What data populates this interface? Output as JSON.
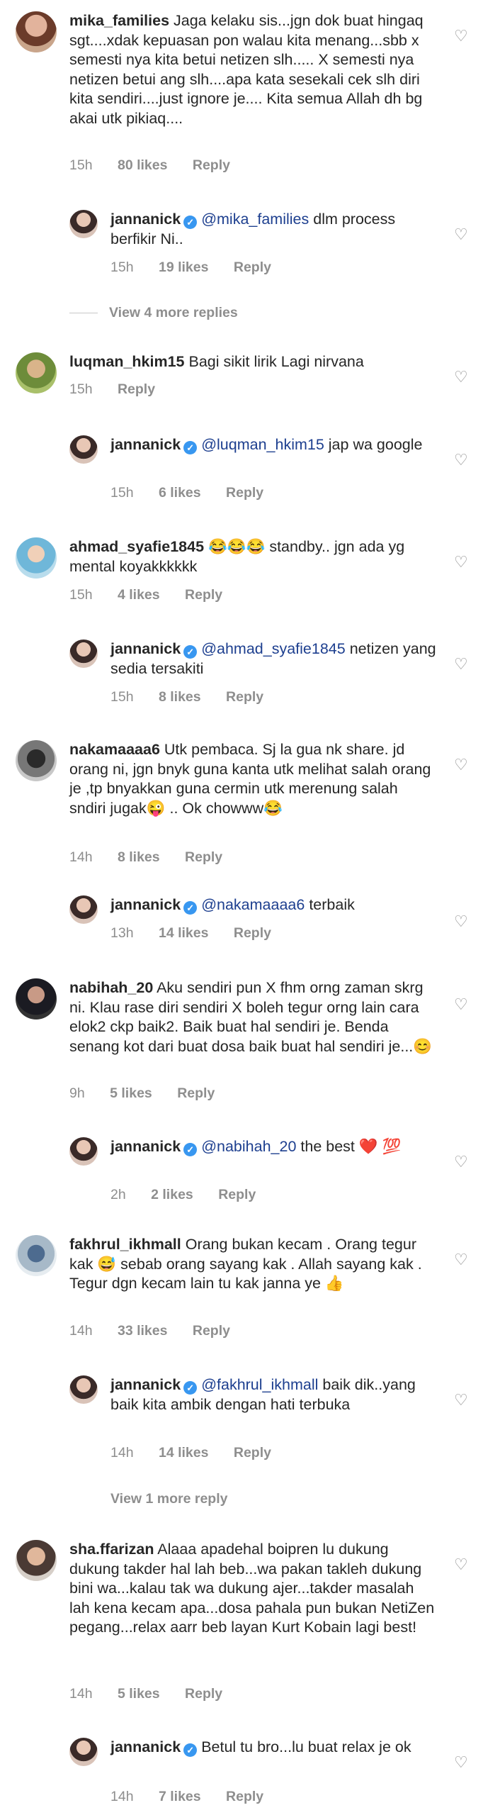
{
  "comments": [
    {
      "id": "c1",
      "user": "mika_families",
      "text": "Jaga kelaku sis...jgn dok buat hingaq sgt....xdak kepuasan pon walau kita menang...sbb x semesti nya kita betui netizen slh..... X semesti nya netizen betui ang slh....apa kata sesekali cek slh diri kita sendiri....just ignore je.... Kita semua Allah dh bg akai utk pikiaq....",
      "time": "15h",
      "likes": "80 likes",
      "reply_label": "Reply"
    },
    {
      "id": "r1",
      "user": "jannanick",
      "mention": "@mika_families",
      "text": "dlm process berfikir Ni..",
      "time": "15h",
      "likes": "19 likes",
      "reply_label": "Reply"
    },
    {
      "id": "c2",
      "user": "luqman_hkim15",
      "text": "Bagi sikit lirik Lagi nirvana",
      "time": "15h",
      "reply_label": "Reply"
    },
    {
      "id": "r2",
      "user": "jannanick",
      "mention": "@luqman_hkim15",
      "text": "jap wa google",
      "time": "15h",
      "likes": "6 likes",
      "reply_label": "Reply"
    },
    {
      "id": "c3",
      "user": "ahmad_syafie1845",
      "text": "😂😂😂 standby.. jgn ada yg mental koyakkkkkk",
      "time": "15h",
      "likes": "4 likes",
      "reply_label": "Reply"
    },
    {
      "id": "r3",
      "user": "jannanick",
      "mention": "@ahmad_syafie1845",
      "text": "netizen yang sedia tersakiti",
      "time": "15h",
      "likes": "8 likes",
      "reply_label": "Reply"
    },
    {
      "id": "c4",
      "user": "nakamaaaa6",
      "text": "Utk pembaca. Sj la gua nk share. jd orang ni, jgn bnyk guna kanta utk melihat salah orang je ,tp bnyakkan guna cermin utk merenung salah sndiri jugak😜 .. Ok chowww😂",
      "time": "14h",
      "likes": "8 likes",
      "reply_label": "Reply"
    },
    {
      "id": "r4",
      "user": "jannanick",
      "mention": "@nakamaaaa6",
      "text": "terbaik",
      "time": "13h",
      "likes": "14 likes",
      "reply_label": "Reply"
    },
    {
      "id": "c5",
      "user": "nabihah_20",
      "text": "Aku sendiri pun X fhm orng zaman skrg ni.  Klau rase diri sendiri X boleh tegur orng lain cara elok2 ckp baik2.  Baik buat hal sendiri je. Benda senang kot dari buat dosa baik buat hal sendiri je...😊",
      "time": "9h",
      "likes": "5 likes",
      "reply_label": "Reply"
    },
    {
      "id": "r5",
      "user": "jannanick",
      "mention": "@nabihah_20",
      "text": "the best ❤️ 💯",
      "time": "2h",
      "likes": "2 likes",
      "reply_label": "Reply"
    },
    {
      "id": "c6",
      "user": "fakhrul_ikhmall",
      "text": "Orang bukan kecam . Orang tegur kak 😅 sebab orang sayang kak . Allah sayang kak . Tegur dgn kecam lain tu kak janna ye 👍",
      "time": "14h",
      "likes": "33 likes",
      "reply_label": "Reply"
    },
    {
      "id": "r6",
      "user": "jannanick",
      "mention": "@fakhrul_ikhmall",
      "text": "baik dik..yang baik kita ambik dengan hati terbuka",
      "time": "14h",
      "likes": "14 likes",
      "reply_label": "Reply"
    },
    {
      "id": "c7",
      "user": "sha.ffarizan",
      "text": "Alaaa apadehal boipren lu dukung dukung takder hal lah beb...wa pakan takleh dukung bini wa...kalau tak wa dukung ajer...takder masalah lah kena kecam apa...dosa pahala pun bukan NetiZen pegang...relax aarr beb layan Kurt Kobain lagi best!",
      "time": "14h",
      "likes": "5 likes",
      "reply_label": "Reply"
    },
    {
      "id": "r7",
      "user": "jannanick",
      "text": "Betul tu bro...lu buat relax je ok",
      "time": "14h",
      "likes": "7 likes",
      "reply_label": "Reply"
    }
  ],
  "view_more": {
    "first": "View 4 more replies",
    "second": "View 1 more reply"
  },
  "icons": {
    "like": "heart-icon",
    "verified": "verified-badge-icon"
  },
  "colors": {
    "verified": "#3897f0",
    "mention": "#1d3f8f",
    "meta": "#8e8e8e"
  }
}
